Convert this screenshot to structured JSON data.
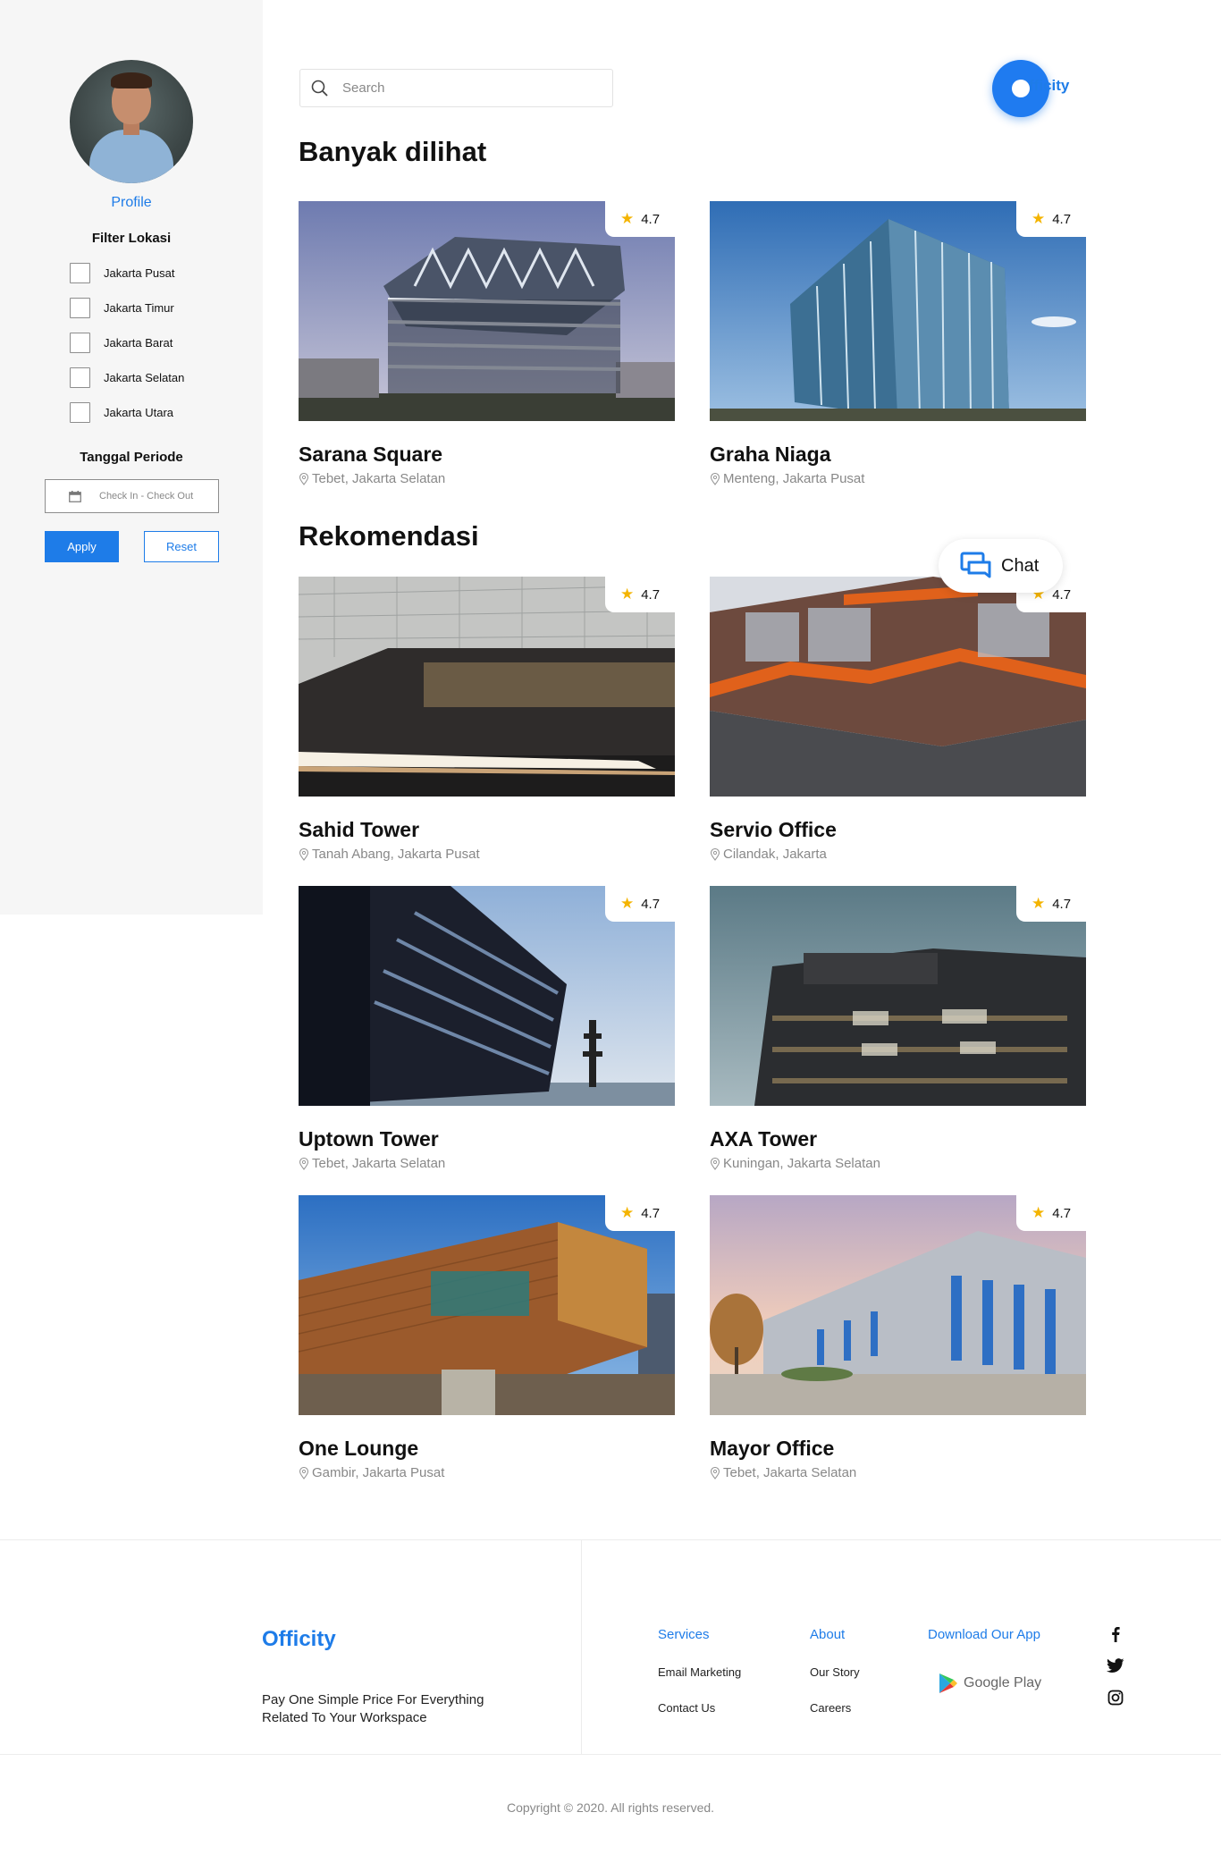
{
  "sidebar": {
    "profile_label": "Profile",
    "filter_title": "Filter Lokasi",
    "locations": [
      "Jakarta Pusat",
      "Jakarta Timur",
      "Jakarta Barat",
      "Jakarta Selatan",
      "Jakarta Utara"
    ],
    "period_title": "Tanggal Periode",
    "date_placeholder": "Check In - Check Out",
    "apply_label": "Apply",
    "reset_label": "Reset"
  },
  "header": {
    "search_placeholder": "Search",
    "logo_text": "fficity"
  },
  "sections": {
    "popular_title": "Banyak dilihat",
    "recommend_title": "Rekomendasi"
  },
  "popular": [
    {
      "name": "Sarana Square",
      "location": "Tebet, Jakarta Selatan",
      "rating": "4.7"
    },
    {
      "name": "Graha Niaga",
      "location": "Menteng, Jakarta Pusat",
      "rating": "4.7"
    }
  ],
  "recommended": [
    {
      "name": "Sahid Tower",
      "location": "Tanah Abang, Jakarta Pusat",
      "rating": "4.7"
    },
    {
      "name": "Servio Office",
      "location": "Cilandak, Jakarta",
      "rating": "4.7"
    },
    {
      "name": "Uptown Tower",
      "location": "Tebet, Jakarta Selatan",
      "rating": "4.7"
    },
    {
      "name": "AXA Tower",
      "location": "Kuningan, Jakarta Selatan",
      "rating": "4.7"
    },
    {
      "name": "One Lounge",
      "location": "Gambir, Jakarta Pusat",
      "rating": "4.7"
    },
    {
      "name": "Mayor Office",
      "location": "Tebet, Jakarta Selatan",
      "rating": "4.7"
    }
  ],
  "chat_label": "Chat",
  "footer": {
    "brand": "Officity",
    "tagline": "Pay One Simple Price For Everything Related To Your Workspace",
    "services_title": "Services",
    "services_links": [
      "Email Marketing",
      "Contact Us"
    ],
    "about_title": "About",
    "about_links": [
      "Our Story",
      "Careers"
    ],
    "download_title": "Download Our App",
    "google_play": "Google Play",
    "social_icons": [
      "facebook-icon",
      "twitter-icon",
      "instagram-icon"
    ],
    "copyright": "Copyright © 2020. All rights reserved."
  },
  "colors": {
    "accent": "#1e7ce8",
    "star": "#f4b400",
    "sidebar_bg": "#f6f6f6"
  }
}
